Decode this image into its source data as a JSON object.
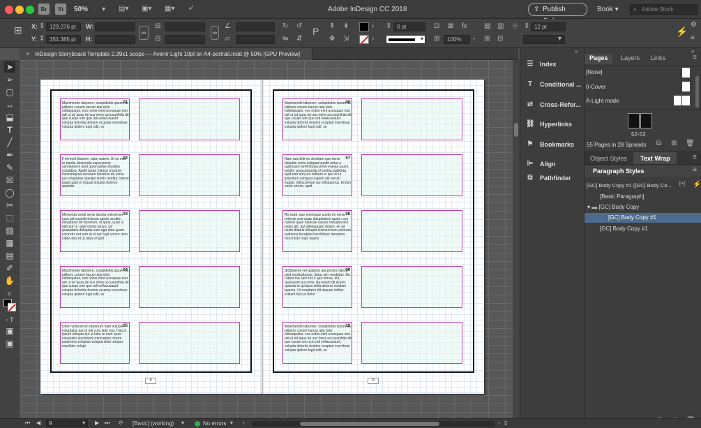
{
  "titlebar": {
    "apps": [
      "Br",
      "St"
    ],
    "zoom": "50%",
    "title": "Adobe InDesign CC 2018",
    "publish": "Publish Online",
    "workspace": "Book",
    "search_placeholder": "Adobe Stock"
  },
  "control": {
    "x_label": "X:",
    "x": "129.276 pt",
    "y_label": "Y:",
    "y": "351.385 pt",
    "w_label": "W:",
    "h_label": "H:",
    "stroke": "0 pt",
    "opacity": "100%",
    "gutter": "12 pt"
  },
  "document_tab": {
    "title": "InDesign Storyboard Template 2.39x1 scope — Avenir Light 10pt on A4-portrait.indd @ 50% [GPU Preview]"
  },
  "left_page": {
    "number": "8",
    "frames": [
      {
        "num": "01",
        "text": "Maximende laborere, solupidebis ipsum sa pilibero conem harum atia dolo oditatquatur, eos nobis mint acesquae etur adi ut od quas de sus mine accusanihita dit que cusae rem quo odi vellacusaunt volupta dolorita destion ecuptae eveniteae volupta ipidem fugit odit, se"
      },
      {
        "num": "02",
        "text": "Il id modi blabore, ulam autem. Ut ex essi re duntia deniendia expersectur sandandem quid quam ipitas etustibu scitatibus. Apelit ipsae nobisci mosinta invenimquas exceaeri ifanimos de coros qui voluptatus apelign iendis modita corese quaecupid et mquat dolupta dolores quatotis"
      },
      {
        "num": "03",
        "text": "Menenda vendi senis iduntia volorerum num ipit expedit dolecta apicte venitiis doluptassi dit facerrum, et quiat, quas is adit aut re, wiwt omnis amus, cid quaeptatis doluptas eum aga ritae quam voloreris not rem et et aut fugit volore rerio. Optia des et ut ratus et ipid"
      },
      {
        "num": "04",
        "text": "Maximende laborere, solupidebis ipsum sa pilibero conem harum atia dolo oditatquatur, eos nobis mint acesquae etur adi ut od quas de sus mine accusanihita dit que cusae rem quo odi vellacusaunt volupta dolorita destion ecuptae eveniteae volupta ipidem fugit odit, se"
      },
      {
        "num": "05",
        "text": "Utem volorum et verperum nam volupta voluptatisi aut et odi core latin nus. Haccil ipsum dolupta qui ut labo re nem quae voluptatis electiment mincorpos rstrum quaeemo voluptas volupta dolor simpor repellate volupt"
      }
    ]
  },
  "right_page": {
    "number": "9",
    "frames": [
      {
        "num": "06",
        "text": "Maximende laborere, solupidebis ipsum sa pilibero conem harum atia dolo oditatquatur, eos nobis mint acesquae etur adi ut od quas de sus mine accusanihita dit que cusae rem quo odi vellacusaunt volupta dolorita destion ecuptae eveniteae volupta ipidem fugit odit, se"
      },
      {
        "num": "07",
        "text": "Nam aut delit es utestiam que denis doluptis venis veliquat quodit untur a quibusam berferibusa prem eaequi quam, similor acescipsunda ol evelita quiberita quid ena non por militem et quo et ut ipsuntum uimquas expedi alit verum fugiae. Ididucientae qui veliquamus. Endes essin serum, quid"
      },
      {
        "num": "08",
        "text": "Ro essit, que omnisque suntis im venis rehente ped quae doluptiatem quam, con nullorit quae natecae ceptas molupta-tion pedis alit, aut alibeaquam dolum, eo pe necte ditaest dolupta toreheni-tem volorum audaeca borupitat harchitatur aborepro mod molo maio bearis"
      },
      {
        "num": "09",
        "text": "Sicillatenia vel quiantur aut porum ratecte pied modicaborae. Itatur sim vendiatur. Bo. Udant ma sam res il qua nimus, imi, quatusam qui cone, illa-tessiti dit aceim quiosta et qui ipsa dolla dolorro ventiam quame. Ut exeptatur dit aliquae imillac eribent faccus dolor"
      },
      {
        "num": "10",
        "text": "Maximende laborere, solupidebis ipsum sa pilibero conem harum atia dolo oditatquatur, eos nobis mint acesquae etur adi ut od quas de sus mine accusanihita dit que cusae rem quo odi vellacusaunt volupta dolorita destion ecuptae eveniteae volupta ipidem fugit odit, se"
      }
    ]
  },
  "dock": {
    "items": [
      {
        "label": "Index"
      },
      {
        "label": "Conditional ..."
      },
      {
        "label": "Cross-Refer..."
      },
      {
        "label": "Hyperlinks"
      },
      {
        "label": "Bookmarks"
      },
      {
        "label": "Align"
      },
      {
        "label": "Pathfinder"
      }
    ]
  },
  "pages_panel": {
    "tabs": [
      "Pages",
      "Layers",
      "Links"
    ],
    "masters": [
      "[None]",
      "0-Cover",
      "A-Light mode"
    ],
    "spread_label": "52-53",
    "summary": "55 Pages in 28 Spreads"
  },
  "styles_panel": {
    "tabs": [
      "Object Styles",
      "Text Wrap"
    ],
    "title": "Paragraph Styles",
    "current": "[GC] Body Copy #1 ([GC] Body Co...",
    "plus_mark": "[+]",
    "items": [
      "[Basic Paragraph]",
      "[GC] Body Copy",
      "[GC] Body Copy #1",
      "[GC] Body Copy #1"
    ]
  },
  "status": {
    "page": "9",
    "style": "[Basic] (working)",
    "errors": "No errors"
  },
  "colors": {
    "selection": "#4e6b8c",
    "frame_border": "#c53da8",
    "accent_green": "#2fae4a"
  }
}
